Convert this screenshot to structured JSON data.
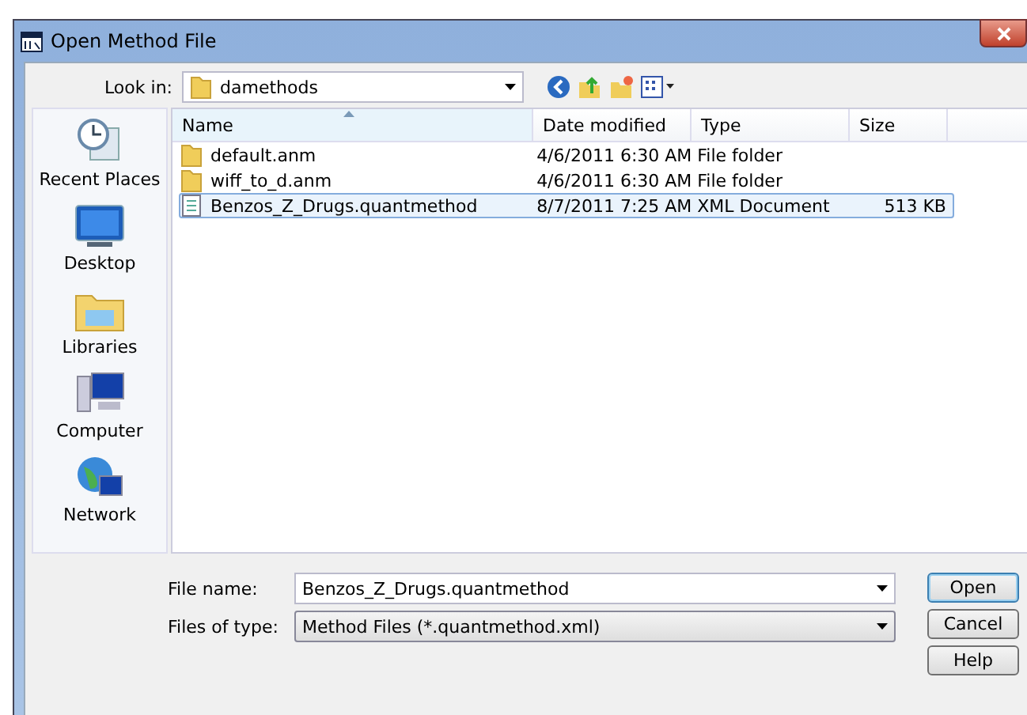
{
  "window": {
    "title": "Open Method File"
  },
  "look_in": {
    "label": "Look in:",
    "value": "damethods"
  },
  "places": [
    {
      "label": "Recent Places",
      "kind": "recent"
    },
    {
      "label": "Desktop",
      "kind": "desktop"
    },
    {
      "label": "Libraries",
      "kind": "libraries"
    },
    {
      "label": "Computer",
      "kind": "computer"
    },
    {
      "label": "Network",
      "kind": "network"
    }
  ],
  "table": {
    "columns": [
      "Name",
      "Date modified",
      "Type",
      "Size"
    ],
    "rows": [
      {
        "kind": "folder",
        "name": "default.anm",
        "date": "4/6/2011 6:30 AM",
        "type": "File folder",
        "selected": false
      },
      {
        "kind": "folder",
        "name": "wiff_to_d.anm",
        "date": "4/6/2011 6:30 AM",
        "type": "File folder",
        "selected": false
      },
      {
        "kind": "document",
        "name": "Benzos_Z_Drugs.quantmethod",
        "date": "8/7/2011 7:25 AM",
        "type": "XML Document",
        "size": "513 KB",
        "selected": true
      }
    ]
  },
  "file_name": {
    "label": "File name:",
    "value": "Benzos_Z_Drugs.quantmethod"
  },
  "file_type": {
    "label": "Files of type:",
    "value": "Method Files (*.quantmethod.xml)"
  },
  "buttons": [
    "Open",
    "Cancel",
    "Help"
  ]
}
